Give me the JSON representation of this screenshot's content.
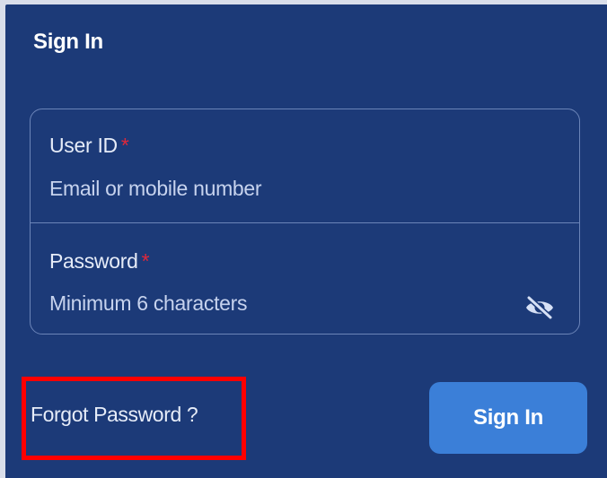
{
  "header": {
    "title": "Sign In"
  },
  "form": {
    "user_id": {
      "label": "User ID",
      "required_marker": "*",
      "placeholder": "Email or mobile number",
      "value": ""
    },
    "password": {
      "label": "Password",
      "required_marker": "*",
      "placeholder": "Minimum 6 characters",
      "value": "",
      "toggle_icon": "eye-off-icon"
    }
  },
  "actions": {
    "forgot_password_label": "Forgot Password ?",
    "sign_in_label": "Sign In"
  },
  "colors": {
    "panel_background": "#1c3a78",
    "button_background": "#3b7fd8",
    "required_marker": "#e0283a",
    "highlight_annotation": "#ff0000"
  }
}
